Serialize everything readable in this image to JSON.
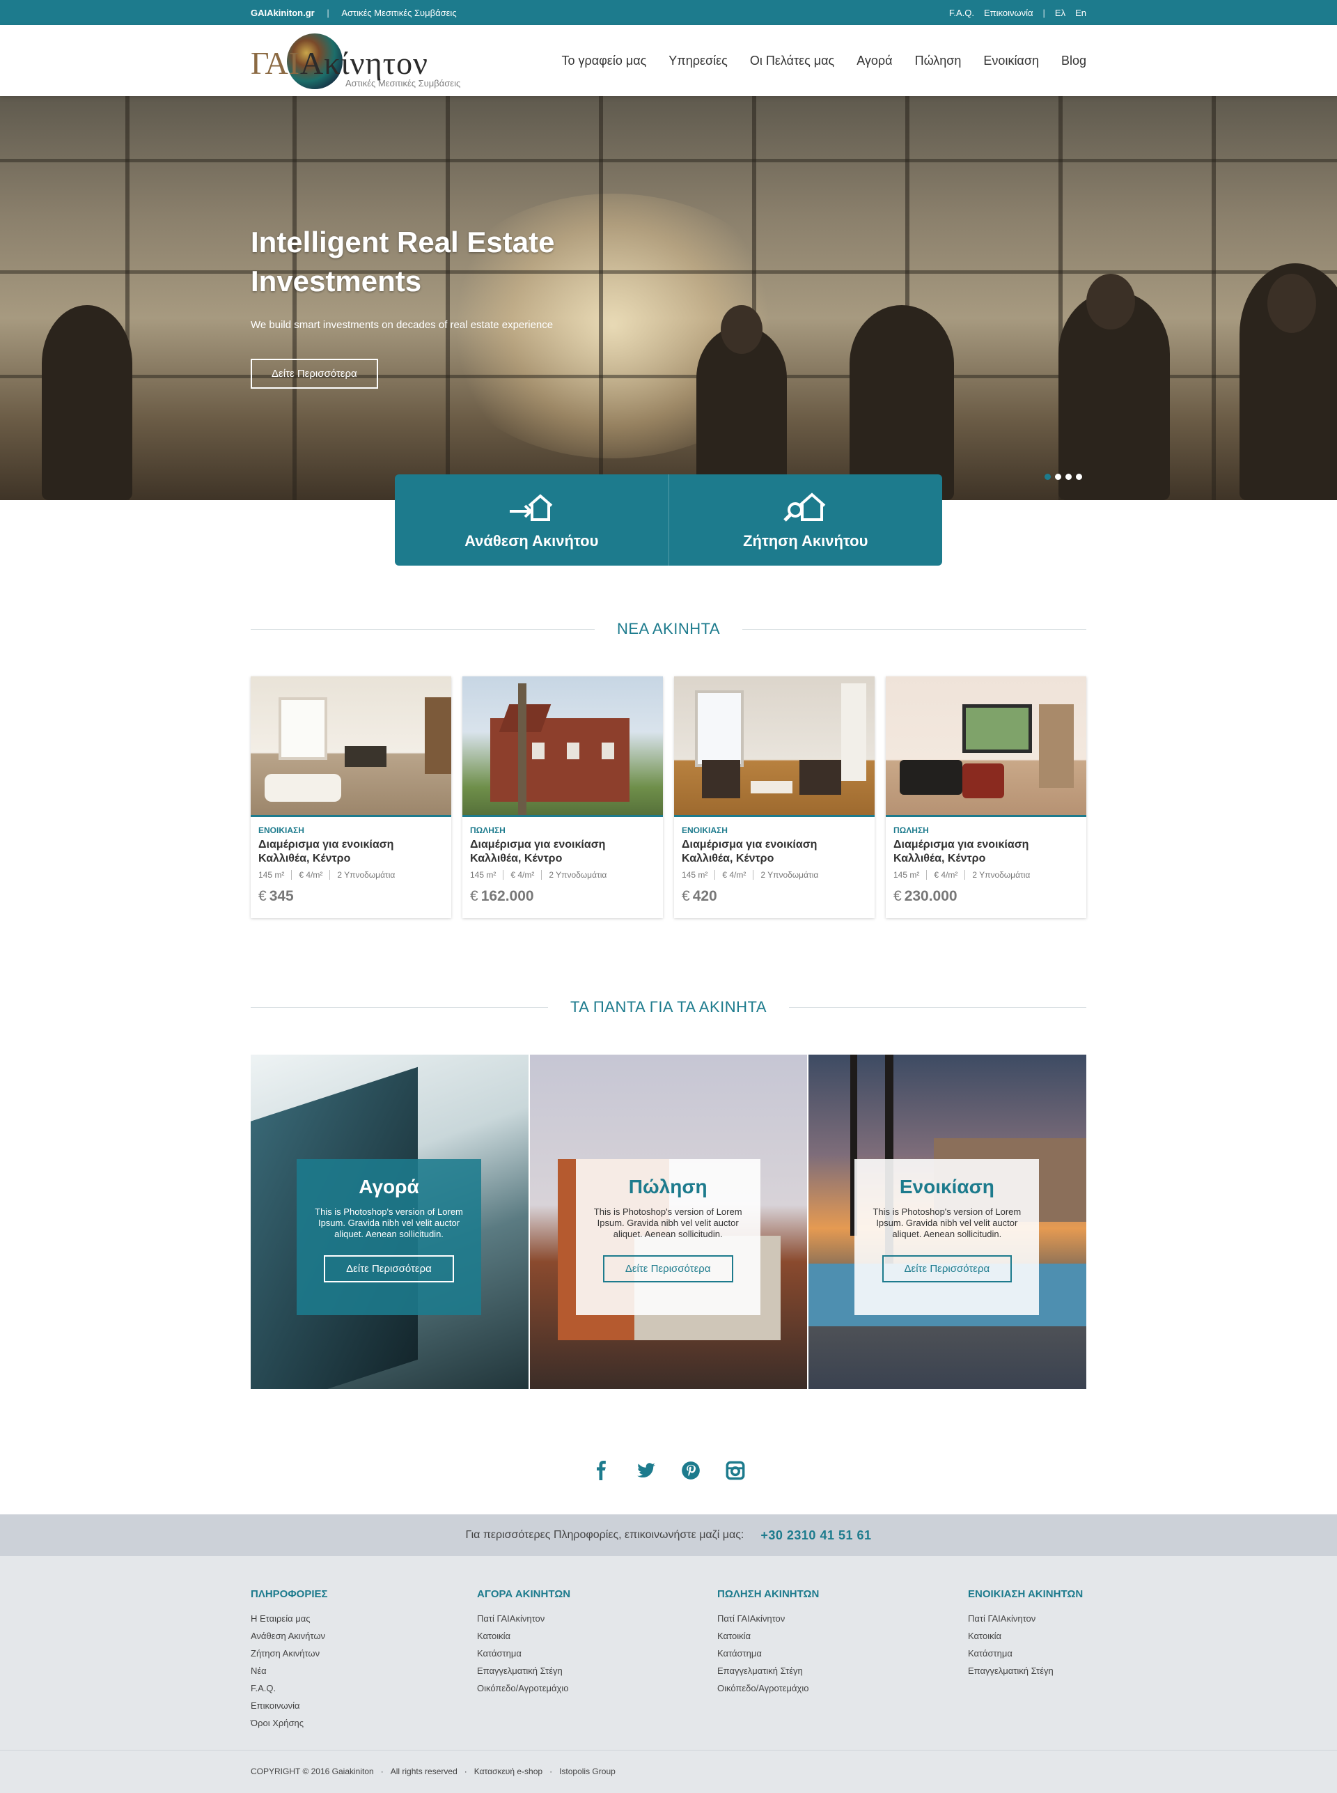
{
  "topbar": {
    "site": "GAIAkiniton.gr",
    "separator": "|",
    "tagline": "Αστικές Μεσιτικές Συμβάσεις",
    "faq": "F.A.Q.",
    "contact": "Επικοινωνία",
    "lang_el": "Ελ",
    "lang_en": "En"
  },
  "logo": {
    "text_a": "ΓΑΙ",
    "text_b": "Ακίνητον",
    "subtitle": "Αστικές Μεσιτικές Συμβάσεις"
  },
  "nav": [
    "Το γραφείο μας",
    "Υπηρεσίες",
    "Οι Πελάτες μας",
    "Αγορά",
    "Πώληση",
    "Ενοικίαση",
    "Blog"
  ],
  "hero": {
    "title": "Intelligent Real Estate Investments",
    "subtitle": "We build smart investments on decades of real estate experience",
    "button": "Δείτε Περισσότερα",
    "slide_count": 4,
    "active_slide": 1
  },
  "actions": [
    {
      "label": "Ανάθεση Ακινήτου",
      "icon": "house-arrow-icon"
    },
    {
      "label": "Ζήτηση Ακινήτου",
      "icon": "house-search-icon"
    }
  ],
  "new_section": {
    "title": "ΝΕΑ ΑΚΙΝΗΤΑ"
  },
  "properties": [
    {
      "type": "ΕΝΟΙΚΙΑΣΗ",
      "title": "Διαμέρισμα για ενοικίαση Καλλιθέα, Κέντρο",
      "area": "145 m²",
      "ppm": "€ 4/m²",
      "rooms": "2 Υπνοδωμάτια",
      "currency": "€",
      "price": "345"
    },
    {
      "type": "ΠΩΛΗΣΗ",
      "title": "Διαμέρισμα για ενοικίαση Καλλιθέα, Κέντρο",
      "area": "145 m²",
      "ppm": "€ 4/m²",
      "rooms": "2 Υπνοδωμάτια",
      "currency": "€",
      "price": "162.000"
    },
    {
      "type": "ΕΝΟΙΚΙΑΣΗ",
      "title": "Διαμέρισμα για ενοικίαση Καλλιθέα, Κέντρο",
      "area": "145 m²",
      "ppm": "€ 4/m²",
      "rooms": "2 Υπνοδωμάτια",
      "currency": "€",
      "price": "420"
    },
    {
      "type": "ΠΩΛΗΣΗ",
      "title": "Διαμέρισμα για ενοικίαση Καλλιθέα, Κέντρο",
      "area": "145 m²",
      "ppm": "€ 4/m²",
      "rooms": "2 Υπνοδωμάτια",
      "currency": "€",
      "price": "230.000"
    }
  ],
  "all_section": {
    "title": "ΤΑ ΠΑΝΤΑ ΓΙΑ ΤΑ ΑΚΙΝΗΤΑ"
  },
  "panels": [
    {
      "title": "Αγορά",
      "text": "This is Photoshop's version of Lorem Ipsum. Gravida nibh vel velit auctor aliquet. Aenean sollicitudin.",
      "button": "Δείτε Περισσότερα"
    },
    {
      "title": "Πώληση",
      "text": "This is Photoshop's version of Lorem Ipsum. Gravida nibh vel velit auctor aliquet. Aenean sollicitudin.",
      "button": "Δείτε Περισσότερα"
    },
    {
      "title": "Ενοικίαση",
      "text": "This is Photoshop's version of Lorem Ipsum. Gravida nibh vel velit auctor aliquet. Aenean sollicitudin.",
      "button": "Δείτε Περισσότερα"
    }
  ],
  "social": [
    "facebook-icon",
    "twitter-icon",
    "pinterest-icon",
    "instagram-icon"
  ],
  "contact": {
    "text": "Για περισσότερες Πληροφορίες, επικοινωνήστε μαζί μας:",
    "phone": "+30  2310 41 51 61"
  },
  "footer": {
    "columns": [
      {
        "title": "ΠΛΗΡΟΦΟΡΙΕΣ",
        "links": [
          "Η Εταιρεία μας",
          "Ανάθεση Ακινήτων",
          "Ζήτηση Ακινήτων",
          "Νέα",
          "F.A.Q.",
          "Επικοινωνία",
          "Όροι Χρήσης"
        ]
      },
      {
        "title": "ΑΓΟΡΑ ΑΚΙΝΗΤΩΝ",
        "links": [
          "Πατί ΓΑΙΑκίνητον",
          "Κατοικία",
          "Κατάστημα",
          "Επαγγελματική Στέγη",
          "Οικόπεδο/Αγροτεμάχιο"
        ]
      },
      {
        "title": "ΠΩΛΗΣΗ ΑΚΙΝΗΤΩΝ",
        "links": [
          "Πατί ΓΑΙΑκίνητον",
          "Κατοικία",
          "Κατάστημα",
          "Επαγγελματική Στέγη",
          "Οικόπεδο/Αγροτεμάχιο"
        ]
      },
      {
        "title": "ΕΝΟΙΚΙΑΣΗ ΑΚΙΝΗΤΩΝ",
        "links": [
          "Πατί ΓΑΙΑκίνητον",
          "Κατοικία",
          "Κατάστημα",
          "Επαγγελματική Στέγη"
        ]
      }
    ],
    "copyright": [
      "COPYRIGHT © 2016  Gaiakiniton",
      "·",
      "All rights reserved",
      "·",
      "Κατασκευή e-shop",
      "·",
      "Istopolis Group"
    ]
  },
  "colors": {
    "accent": "#1d7b8d",
    "contact_band": "#ccd1d8",
    "footer_bg": "#e4e7ea"
  }
}
